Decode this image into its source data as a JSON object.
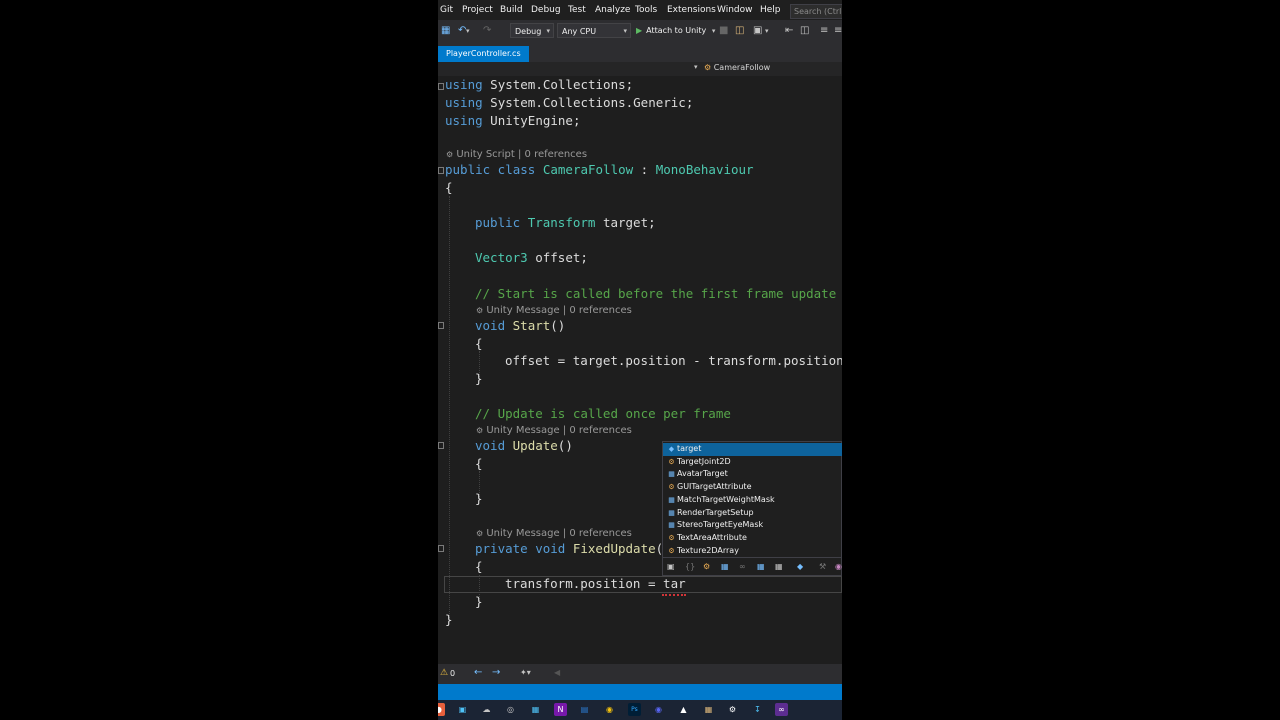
{
  "menu": [
    "Git",
    "Project",
    "Build",
    "Debug",
    "Test",
    "Analyze",
    "Tools",
    "Extensions",
    "Window",
    "Help"
  ],
  "search": {
    "placeholder": "Search (Ctrl+Q)"
  },
  "toolbar": {
    "configuration": "Debug",
    "platform": "Any CPU",
    "attach_label": "Attach to Unity"
  },
  "tab": {
    "label": "PlayerController.cs"
  },
  "navbar": {
    "member": "CameraFollow"
  },
  "code": {
    "using1_kw": "using",
    "using1_ns": " System.Collections;",
    "using2_kw": "using",
    "using2_ns": " System.Collections.Generic;",
    "using3_kw": "using",
    "using3_ns": " UnityEngine;",
    "lens_class": "Unity Script | 0 references",
    "class_kw": "public class ",
    "class_name": "CameraFollow",
    "class_colon": " : ",
    "class_base": "MonoBehaviour",
    "brace_open": "{",
    "field1_kw": "public ",
    "field1_type": "Transform",
    "field1_name": " target;",
    "field2_type": "Vector3",
    "field2_name": " offset;",
    "comment_start": "// Start is called before the first frame update",
    "lens_start": "Unity Message | 0 references",
    "start_kw": "void ",
    "start_name": "Start",
    "start_parens": "()",
    "start_brace_open": "{",
    "start_body": "offset = target.position - transform.position",
    "start_brace_close": "}",
    "comment_update": "// Update is called once per frame",
    "lens_update": "Unity Message | 0 references",
    "update_kw": "void ",
    "update_name": "Update",
    "update_parens": "()",
    "update_brace_open": "{",
    "update_brace_close": "}",
    "lens_fixed": "Unity Message | 0 references",
    "fixed_kw": "private void ",
    "fixed_name": "FixedUpdate",
    "fixed_parens": "(",
    "fixed_brace_open": "{",
    "fixed_body": "transform.position = tar",
    "fixed_brace_close": "}",
    "brace_close": "}"
  },
  "completion": {
    "items": [
      {
        "label": "target",
        "icon": "field-icon",
        "selected": true
      },
      {
        "label": "TargetJoint2D",
        "icon": "class-icon"
      },
      {
        "label": "AvatarTarget",
        "icon": "enum-icon"
      },
      {
        "label": "GUITargetAttribute",
        "icon": "class-icon"
      },
      {
        "label": "MatchTargetWeightMask",
        "icon": "struct-icon"
      },
      {
        "label": "RenderTargetSetup",
        "icon": "struct-icon"
      },
      {
        "label": "StereoTargetEyeMask",
        "icon": "enum-icon"
      },
      {
        "label": "TextAreaAttribute",
        "icon": "class-icon"
      },
      {
        "label": "Texture2DArray",
        "icon": "class-icon"
      }
    ]
  },
  "bottom": {
    "errors": "0"
  },
  "colors": {
    "accent": "#007acc",
    "keyword": "#569cd6",
    "type": "#4ec9b0",
    "comment": "#57a64a",
    "editor_bg": "#1e1e1e"
  }
}
